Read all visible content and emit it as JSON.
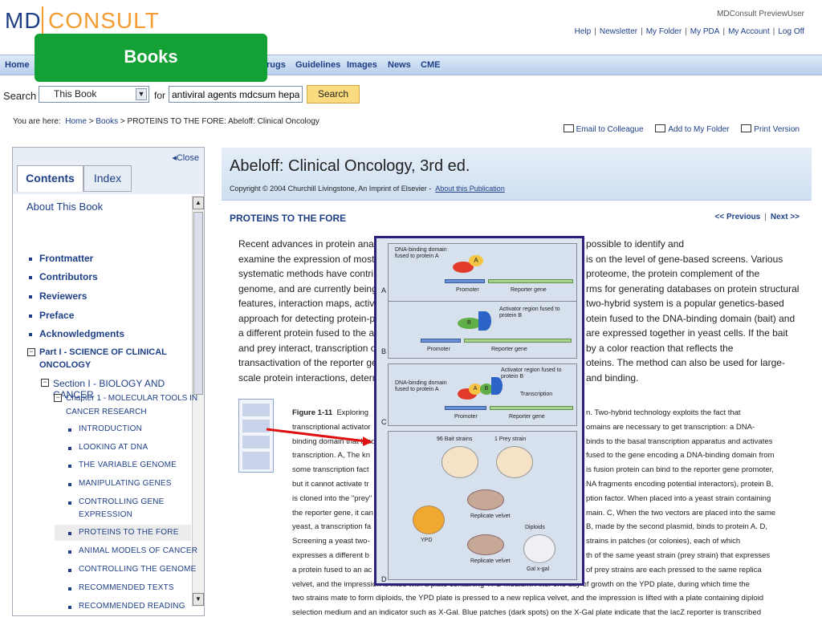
{
  "header": {
    "logo_md": "MD",
    "logo_consult": "CONSULT",
    "user": "MDConsult PreviewUser",
    "links": [
      "Help",
      "Newsletter",
      "My Folder",
      "My PDA",
      "My Account",
      "Log Off"
    ]
  },
  "nav": {
    "home": "Home",
    "drugs": "rugs",
    "guidelines": "Guidelines",
    "images": "Images",
    "news": "News",
    "cme": "CME",
    "books_overlay": "Books"
  },
  "search": {
    "label": "Search",
    "scope": "This Book",
    "for": "for",
    "query": "antiviral agents mdcsum hepati",
    "button": "Search"
  },
  "breadcrumb": {
    "prefix": "You are here:",
    "home": "Home",
    "books": "Books",
    "current": "PROTEINS TO THE FORE: Abeloff: Clinical Oncology"
  },
  "tools": {
    "email": "Email to Colleague",
    "folder": "Add to My Folder",
    "print": "Print Version"
  },
  "sidebar": {
    "close": "◂Close",
    "tab_contents": "Contents",
    "tab_index": "Index",
    "about": "About This Book",
    "items": [
      "Frontmatter",
      "Contributors",
      "Reviewers",
      "Preface",
      "Acknowledgments"
    ],
    "part1_line1": "Part I - SCIENCE OF CLINICAL",
    "part1_line2": "ONCOLOGY",
    "section1": "Section I - BIOLOGY AND CANCER",
    "chapter1_line1": "Chapter 1 - MOLECULAR TOOLS IN",
    "chapter1_line2": "CANCER RESEARCH",
    "subitems": [
      "INTRODUCTION",
      "LOOKING AT DNA",
      "THE VARIABLE GENOME",
      "MANIPULATING GENES",
      "CONTROLLING GENE",
      "PROTEINS TO THE FORE",
      "ANIMAL MODELS OF CANCER",
      "CONTROLLING THE GENOME",
      "RECOMMENDED TEXTS",
      "RECOMMENDED READING"
    ],
    "subitem_cont": "EXPRESSION"
  },
  "main": {
    "title": "Abeloff: Clinical Oncology, 3rd ed.",
    "copyright": "Copyright © 2004 Churchill Livingstone, An Imprint of Elsevier -",
    "about_pub": "About this Publication",
    "section_title": "PROTEINS TO THE FORE",
    "prev": "<< Previous",
    "next": "Next >>",
    "para_left": [
      "Recent advances in protein analy",
      "examine the expression of most",
      "systematic methods have contril",
      "genome, and are currently being",
      "features, interaction maps, activ",
      "approach for detecting protein-pr",
      "a different protein fused to the ac",
      "and prey interact, transcription o",
      "transactivation of the reporter ge",
      "scale protein interactions, determ"
    ],
    "para_right": [
      "possible to identify and",
      "is on the level of gene-based screens. Various",
      "proteome, the protein complement of the",
      "rms for generating databases on protein structural",
      "two-hybrid system is a popular genetics-based",
      "otein fused to the DNA-binding domain (bait) and",
      "are expressed together in yeast cells. If the bait",
      "by a color reaction that reflects the",
      "oteins. The method can also be used for large-",
      "and binding."
    ],
    "caption_left": [
      "Figure 1-11  Exploring",
      "transcriptional activator",
      "binding domain that bind",
      "transcription. A, The kn",
      "some transcription fact",
      "but it cannot activate tr",
      "is cloned into the \"prey\"",
      "the reporter gene, it can",
      "yeast, a transcription fa",
      "Screening a yeast two-",
      "expresses a different b",
      "a protein fused to an ac"
    ],
    "caption_right": [
      "n. Two-hybrid technology exploits the fact that",
      "omains are necessary to get transcription: a DNA-",
      "binds to the basal transcription apparatus and activates",
      "fused to the gene encoding a DNA-binding domain from",
      "is fusion protein can bind to the reporter gene promoter,",
      "NA fragments encoding potential interactors), protein B,",
      "ption factor. When placed into a yeast strain containing",
      "main. C, When the two vectors are placed into the same",
      "B, made by the second plasmid, binds to protein A. D,",
      "strains in patches (or colonies), each of which",
      "th of the same yeast strain (prey strain) that expresses",
      "of prey strains are each pressed to the same replica"
    ],
    "caption_full": [
      "velvet, and the impression is lifted with a plate containing YPD medium. After one day of growth on the YPD plate, during which time the",
      "two strains mate to form diploids, the YPD plate is pressed to a new replica velvet, and the impression is lifted with a plate containing diploid",
      "selection medium and an indicator such as X-Gal. Blue patches (dark spots) on the X-Gal plate indicate that the lacZ reporter is transcribed"
    ]
  },
  "figure": {
    "a_dbd": "DNA-binding domain fused to protein A",
    "promoter": "Promoter",
    "reporter": "Reporter gene",
    "activator": "Activator region fused to protein B",
    "transcription": "Transcription",
    "bait": "96 Bait strains",
    "prey": "1 Prey strain",
    "velvet": "Replicate velvet",
    "diploids": "Diploids",
    "ypd": "YPD",
    "xgal": "Gal x-gal",
    "labels": [
      "A",
      "B",
      "C",
      "D"
    ],
    "prot_a": "A",
    "prot_b": "B"
  }
}
